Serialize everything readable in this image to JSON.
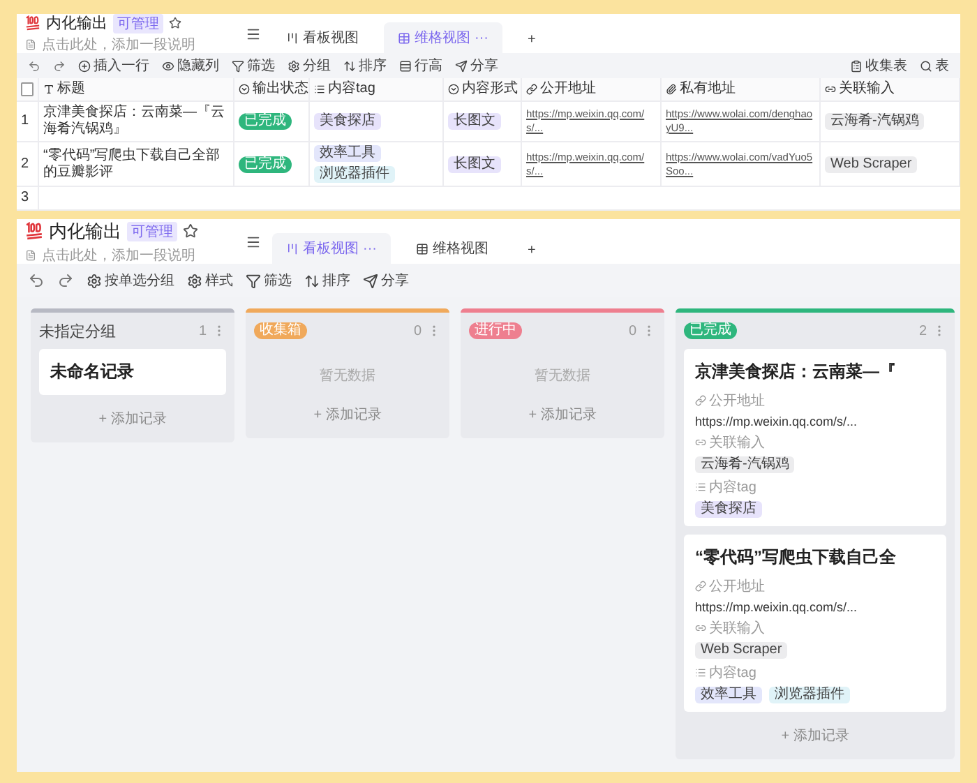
{
  "table_view": {
    "title": "内化输出",
    "badge": "可管理",
    "description": "点击此处，添加一段说明",
    "tabs": [
      {
        "label": "看板视图",
        "selected": false
      },
      {
        "label": "维格视图",
        "selected": true,
        "menu": "···"
      },
      {
        "label": "+",
        "kind": "add",
        "selected": false
      }
    ],
    "toolbar": [
      {
        "kind": "undo"
      },
      {
        "kind": "redo"
      },
      {
        "kind": "insert",
        "label": "插入一行"
      },
      {
        "kind": "hide",
        "label": "隐藏列"
      },
      {
        "kind": "filter",
        "label": "筛选"
      },
      {
        "kind": "group",
        "label": "分组"
      },
      {
        "kind": "sort",
        "label": "排序"
      },
      {
        "kind": "height",
        "label": "行高"
      },
      {
        "kind": "share",
        "label": "分享"
      }
    ],
    "right_tools": [
      {
        "kind": "form",
        "label": "收集表"
      },
      {
        "kind": "search",
        "label": "表"
      }
    ],
    "select_all": {
      "checked": false
    },
    "columns": [
      {
        "kind": "text",
        "label": "标题"
      },
      {
        "kind": "select",
        "label": "输出状态"
      },
      {
        "kind": "tags",
        "label": "内容tag"
      },
      {
        "kind": "select",
        "label": "内容形式"
      },
      {
        "kind": "link",
        "label": "公开地址"
      },
      {
        "kind": "attach",
        "label": "私有地址"
      },
      {
        "kind": "relation",
        "label": "关联输入"
      }
    ],
    "rows": [
      {
        "number": "1",
        "title": "京津美食探店：云南菜—『云海肴汽锅鸡』",
        "status": {
          "label": "已完成",
          "color": "#2eb67d"
        },
        "tags": [
          {
            "label": "美食探店",
            "color": "#e7e3fb"
          }
        ],
        "form": {
          "label": "长图文",
          "color": "#e7e3fb"
        },
        "public_url": "https://mp.weixin.qq.com/s/...",
        "private_url": "https://www.wolai.com/denghaoyU9...",
        "relation": "云海肴-汽锅鸡"
      },
      {
        "number": "2",
        "title": "“零代码”写爬虫下载自己全部的豆瓣影评",
        "status": {
          "label": "已完成",
          "color": "#2eb67d"
        },
        "tags": [
          {
            "label": "效率工具",
            "color": "#e3e6fb"
          },
          {
            "label": "浏览器插件",
            "color": "#e0f3f8"
          }
        ],
        "form": {
          "label": "长图文",
          "color": "#e7e3fb"
        },
        "public_url": "https://mp.weixin.qq.com/s/...",
        "private_url": "https://www.wolai.com/vadYuo5Soo...",
        "relation": "Web Scraper"
      }
    ],
    "empty_row": "3"
  },
  "kanban_view": {
    "title": "内化输出",
    "badge": "可管理",
    "description": "点击此处，添加一段说明",
    "tabs": [
      {
        "label": "看板视图",
        "selected": true,
        "menu": "···"
      },
      {
        "label": "维格视图",
        "selected": false
      },
      {
        "label": "+",
        "kind": "add",
        "selected": false
      }
    ],
    "toolbar": [
      {
        "kind": "undo"
      },
      {
        "kind": "redo"
      },
      {
        "kind": "group",
        "label": "按单选分组"
      },
      {
        "kind": "style",
        "label": "样式"
      },
      {
        "kind": "filter",
        "label": "筛选"
      },
      {
        "kind": "sort",
        "label": "排序"
      },
      {
        "kind": "share",
        "label": "分享"
      }
    ],
    "groups": [
      {
        "name": "未指定分组",
        "kind": "plain",
        "color": "#b7b9c3",
        "count": "1",
        "records": [
          {
            "title": "未命名记录"
          }
        ],
        "add_label": "+ 添加记录"
      },
      {
        "name": "收集箱",
        "kind": "pill",
        "color": "#f0a95b",
        "count": "0",
        "empty_text": "暂无数据",
        "add_label": "+ 添加记录"
      },
      {
        "name": "进行中",
        "kind": "pill",
        "color": "#ee7f8f",
        "count": "0",
        "empty_text": "暂无数据",
        "add_label": "+ 添加记录"
      },
      {
        "name": "已完成",
        "kind": "pill",
        "color": "#2eb67d",
        "count": "2",
        "records": [
          {
            "title": "京津美食探店：云南菜—『",
            "fields": [
              {
                "kind": "link",
                "label": "公开地址",
                "value": "https://mp.weixin.qq.com/s/..."
              },
              {
                "kind": "relation",
                "label": "关联输入",
                "tags": [
                  {
                    "label": "云海肴-汽锅鸡",
                    "color": "#ececee"
                  }
                ]
              },
              {
                "kind": "tags",
                "label": "内容tag",
                "tags": [
                  {
                    "label": "美食探店",
                    "color": "#e7e3fb"
                  }
                ]
              }
            ]
          },
          {
            "title": "“零代码”写爬虫下载自己全",
            "fields": [
              {
                "kind": "link",
                "label": "公开地址",
                "value": "https://mp.weixin.qq.com/s/..."
              },
              {
                "kind": "relation",
                "label": "关联输入",
                "tags": [
                  {
                    "label": "Web Scraper",
                    "color": "#ececee"
                  }
                ]
              },
              {
                "kind": "tags",
                "label": "内容tag",
                "tags": [
                  {
                    "label": "效率工具",
                    "color": "#e3e6fb"
                  },
                  {
                    "label": "浏览器插件",
                    "color": "#e0f3f8"
                  }
                ]
              }
            ]
          }
        ],
        "add_label": "+ 添加记录"
      }
    ]
  }
}
